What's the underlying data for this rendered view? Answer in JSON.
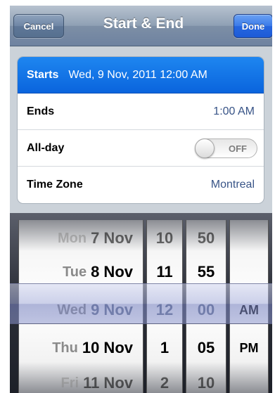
{
  "navbar": {
    "cancel_label": "Cancel",
    "title": "Start & End",
    "done_label": "Done"
  },
  "rows": {
    "starts_label": "Starts",
    "starts_value": "Wed, 9 Nov, 2011  12:00 AM",
    "ends_label": "Ends",
    "ends_value": "1:00 AM",
    "allday_label": "All-day",
    "allday_toggle": "OFF",
    "timezone_label": "Time Zone",
    "timezone_value": "Montreal"
  },
  "picker": {
    "dates": [
      {
        "dow": "Mon",
        "day": "7 Nov"
      },
      {
        "dow": "Tue",
        "day": "8 Nov"
      },
      {
        "dow": "Wed",
        "day": "9 Nov"
      },
      {
        "dow": "Thu",
        "day": "10 Nov"
      },
      {
        "dow": "Fri",
        "day": "11 Nov"
      }
    ],
    "hours": [
      "10",
      "11",
      "12",
      "1",
      "2"
    ],
    "minutes": [
      "50",
      "55",
      "00",
      "05",
      "10"
    ],
    "ampm": [
      "AM",
      "PM"
    ]
  },
  "colors": {
    "selected_row": "#0a64dd",
    "detail_text": "#385487",
    "done_button": "#2666df"
  }
}
